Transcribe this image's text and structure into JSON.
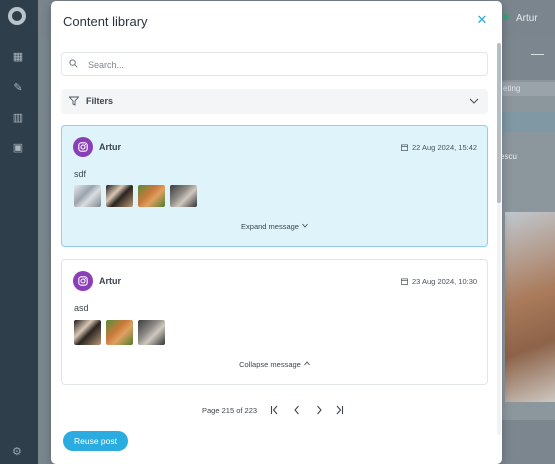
{
  "background_app": {
    "user_name": "Artur",
    "tab_label": "eting",
    "side_text": "escu"
  },
  "modal": {
    "title": "Content library",
    "close_icon": "close-icon"
  },
  "search": {
    "placeholder": "Search...",
    "value": ""
  },
  "filters": {
    "label": "Filters"
  },
  "posts": [
    {
      "author": "Artur",
      "platform_icon": "instagram-icon",
      "date": "22 Aug 2024, 15:42",
      "message": "sdf",
      "thumbnails": [
        "image-building",
        "image-cats",
        "image-kitten",
        "image-tabby"
      ],
      "toggle_label": "Expand message",
      "selected": true
    },
    {
      "author": "Artur",
      "platform_icon": "instagram-icon",
      "date": "23 Aug 2024, 10:30",
      "message": "asd",
      "thumbnails": [
        "image-cats",
        "image-kitten",
        "image-tabby"
      ],
      "toggle_label": "Collapse message",
      "selected": false
    }
  ],
  "pagination": {
    "text": "Page 215 of 223",
    "current": 215,
    "total": 223
  },
  "actions": {
    "reuse_label": "Reuse post"
  },
  "colors": {
    "accent": "#2bace0",
    "selected_card_bg": "#dff3fa",
    "selected_card_border": "#8fd0e6",
    "instagram": "#8a3fb8"
  }
}
